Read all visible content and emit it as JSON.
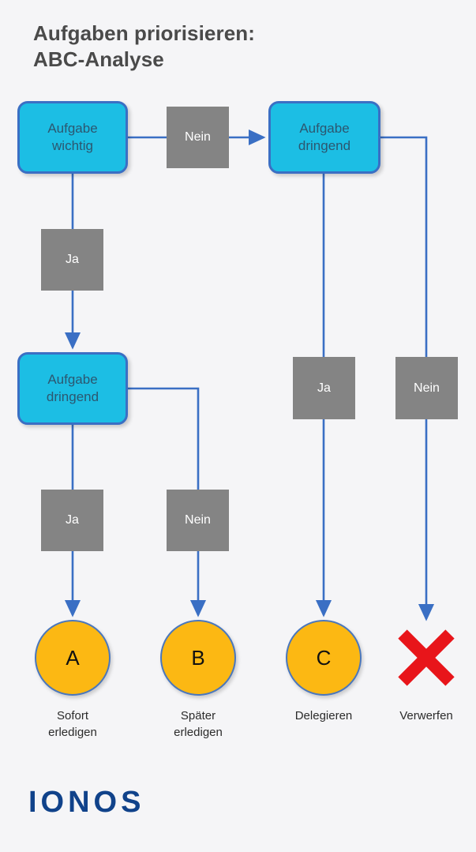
{
  "page": {
    "title": "Aufgaben priorisieren:\nABC-Analyse",
    "background_color": "#f5f5f7",
    "logo_text": "IONOS"
  },
  "colors": {
    "decision_fill": "#1cbee4",
    "decision_border": "#3a6fc4",
    "decision_text": "#2c5770",
    "label_fill": "#848484",
    "label_text": "#ffffff",
    "result_fill": "#fcb813",
    "result_border": "#4a77bd",
    "connector": "#3a6fc4",
    "reject_mark": "#e8151a",
    "title_text": "#4a4a4a",
    "logo": "#10428a"
  },
  "decisions": [
    {
      "id": "aufgabe-wichtig",
      "label": "Aufgabe\nwichtig"
    },
    {
      "id": "aufgabe-dringend-right",
      "label": "Aufgabe\ndringend"
    },
    {
      "id": "aufgabe-dringend-left",
      "label": "Aufgabe\ndringend"
    }
  ],
  "edge_labels": [
    {
      "id": "wichtig-nein",
      "label": "Nein"
    },
    {
      "id": "wichtig-ja",
      "label": "Ja"
    },
    {
      "id": "dringend-left-ja",
      "label": "Ja"
    },
    {
      "id": "dringend-left-nein",
      "label": "Nein"
    },
    {
      "id": "dringend-right-ja",
      "label": "Ja"
    },
    {
      "id": "dringend-right-nein",
      "label": "Nein"
    }
  ],
  "results": [
    {
      "id": "result-a",
      "letter": "A",
      "caption": "Sofort\nerledigen"
    },
    {
      "id": "result-b",
      "letter": "B",
      "caption": "Später\nerledigen"
    },
    {
      "id": "result-c",
      "letter": "C",
      "caption": "Delegieren"
    },
    {
      "id": "result-x",
      "letter": "",
      "caption": "Verwerfen"
    }
  ],
  "chart_data": {
    "type": "diagram",
    "title": "Aufgaben priorisieren: ABC-Analyse",
    "nodes": [
      {
        "id": "aufgabe-wichtig",
        "text": "Aufgabe wichtig",
        "kind": "decision"
      },
      {
        "id": "aufgabe-dringend-left",
        "text": "Aufgabe dringend",
        "kind": "decision"
      },
      {
        "id": "aufgabe-dringend-right",
        "text": "Aufgabe dringend",
        "kind": "decision"
      },
      {
        "id": "result-a",
        "text": "A - Sofort erledigen",
        "kind": "result"
      },
      {
        "id": "result-b",
        "text": "B - Später erledigen",
        "kind": "result"
      },
      {
        "id": "result-c",
        "text": "C - Delegieren",
        "kind": "result"
      },
      {
        "id": "result-x",
        "text": "Verwerfen",
        "kind": "reject"
      }
    ],
    "edges": [
      {
        "from": "aufgabe-wichtig",
        "to": "aufgabe-dringend-left",
        "label": "Ja"
      },
      {
        "from": "aufgabe-wichtig",
        "to": "aufgabe-dringend-right",
        "label": "Nein"
      },
      {
        "from": "aufgabe-dringend-left",
        "to": "result-a",
        "label": "Ja"
      },
      {
        "from": "aufgabe-dringend-left",
        "to": "result-b",
        "label": "Nein"
      },
      {
        "from": "aufgabe-dringend-right",
        "to": "result-c",
        "label": "Ja"
      },
      {
        "from": "aufgabe-dringend-right",
        "to": "result-x",
        "label": "Nein"
      }
    ]
  }
}
